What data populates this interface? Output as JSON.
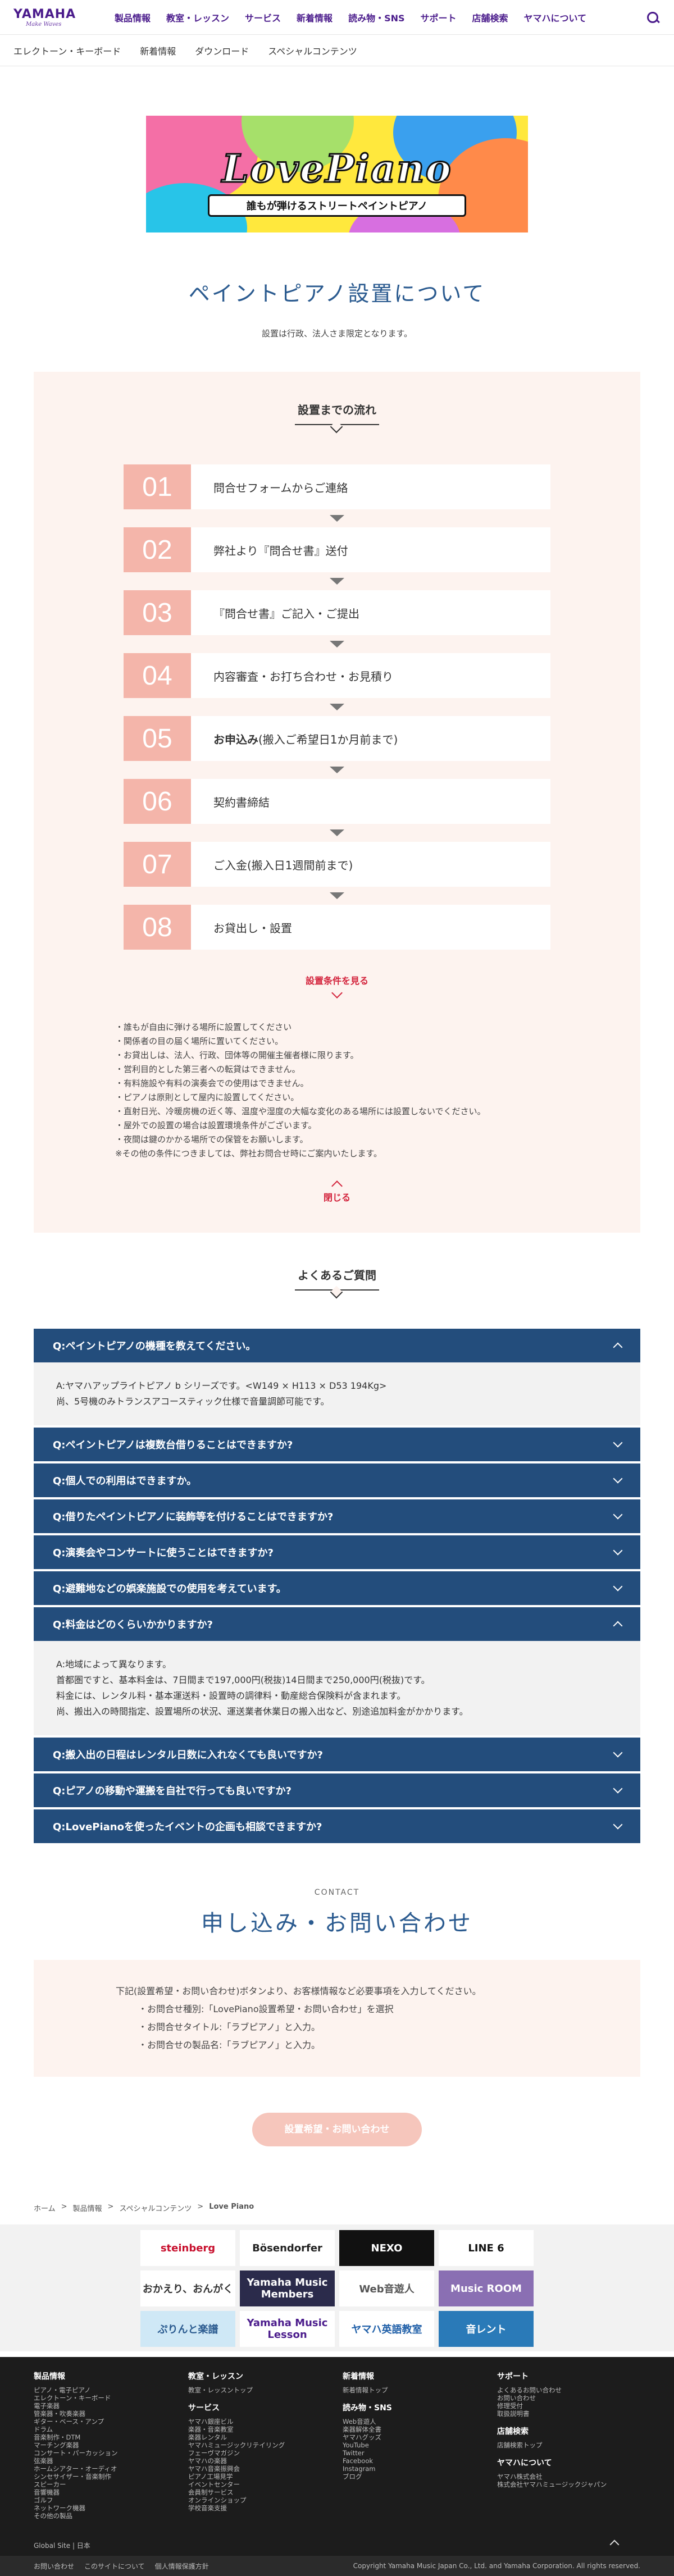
{
  "header": {
    "brand": "YAMAHA",
    "brand_sub": "Make Waves",
    "nav": [
      "製品情報",
      "教室・レッスン",
      "サービス",
      "新着情報",
      "読み物・SNS",
      "サポート",
      "店舗検索",
      "ヤマハについて"
    ]
  },
  "subnav": [
    "エレクトーン・キーボード",
    "新着情報",
    "ダウンロード",
    "スペシャルコンテンツ"
  ],
  "banner": {
    "logo_text": "LovePiano",
    "tagline": "誰もが弾けるストリートペイントピアノ"
  },
  "page": {
    "title": "ペイントピアノ設置について",
    "note": "設置は行政、法人さま限定となります。"
  },
  "flow": {
    "heading": "設置までの流れ",
    "steps": [
      {
        "num": "01",
        "label": "問合せフォームからご連絡"
      },
      {
        "num": "02",
        "label": "弊社より『問合せ書』送付"
      },
      {
        "num": "03",
        "label": "『問合せ書』ご記入・ご提出"
      },
      {
        "num": "04",
        "label": "内容審査・お打ち合わせ・お見積り"
      },
      {
        "num": "05",
        "label_strong": "お申込み",
        "label": "(搬入ご希望日1か月前まで)"
      },
      {
        "num": "06",
        "label": "契約書締結"
      },
      {
        "num": "07",
        "label": "ご入金(搬入日1週間前まで)"
      },
      {
        "num": "08",
        "label": "お貸出し・設置"
      }
    ],
    "conditions_toggle": "設置条件を見る",
    "conditions": [
      "・誰もが自由に弾ける場所に設置してください",
      "・関係者の目の届く場所に置いてください。",
      "・お貸出しは、法人、行政、団体等の開催主催者様に限ります。",
      "・営利目的とした第三者への転貸はできません。",
      "・有料施設や有料の演奏会での使用はできません。",
      "・ピアノは原則として屋内に設置してください。",
      "・直射日光、冷暖房機の近く等、温度や湿度の大幅な変化のある場所には設置しないでください。",
      "・屋外での設置の場合は設置環境条件がございます。",
      "・夜間は鍵のかかる場所での保管をお願いします。",
      "※その他の条件につきましては、弊社お問合せ時にご案内いたします。"
    ],
    "close_toggle": "閉じる"
  },
  "faq": {
    "heading": "よくあるご質問",
    "items": [
      {
        "q": "Q:ペイントピアノの機種を教えてください。",
        "open": true,
        "a": [
          "A:ヤマハアップライトピアノ b シリーズです。<W149 × H113 × D53 194Kg>",
          "尚、5号機のみトランスアコースティック仕様で音量調節可能です。"
        ]
      },
      {
        "q": "Q:ペイントピアノは複数台借りることはできますか?",
        "open": false
      },
      {
        "q": "Q:個人での利用はできますか。",
        "open": false
      },
      {
        "q": "Q:借りたペイントピアノに装飾等を付けることはできますか?",
        "open": false
      },
      {
        "q": "Q:演奏会やコンサートに使うことはできますか?",
        "open": false
      },
      {
        "q": "Q:避難地などの娯楽施設での使用を考えています。",
        "open": false
      },
      {
        "q": "Q:料金はどのくらいかかりますか?",
        "open": true,
        "a": [
          "A:地域によって異なります。",
          "首都圏ですと、基本料金は、7日間まで197,000円(税抜)14日間まで250,000円(税抜)です。",
          "料金には、レンタル料・基本運送料・設置時の調律料・動産総合保険料が含まれます。",
          "尚、搬出入の時間指定、設置場所の状況、運送業者休業日の搬入出など、別途追加料金がかかります。"
        ]
      },
      {
        "q": "Q:搬入出の日程はレンタル日数に入れなくても良いですか?",
        "open": false
      },
      {
        "q": "Q:ピアノの移動や運搬を自社で行っても良いですか?",
        "open": false
      },
      {
        "q": "Q:LovePianoを使ったイベントの企画も相談できますか?",
        "open": false
      }
    ]
  },
  "contact": {
    "eyebrow": "CONTACT",
    "title": "申し込み・お問い合わせ",
    "intro": "下記(設置希望・お問い合わせ)ボタンより、お客様情報など必要事項を入力してください。",
    "lines": [
      "・お問合せ種別:「LovePiano設置希望・お問い合わせ」を選択",
      "・お問合せタイトル:「ラブピアノ」と入力。",
      "・お問合せの製品名:「ラブピアノ」と入力。"
    ],
    "cta": "設置希望・お問い合わせ"
  },
  "breadcrumb": [
    "ホーム",
    "製品情報",
    "スペシャルコンテンツ",
    "Love Piano"
  ],
  "brands": [
    {
      "name": "steinberg",
      "bg": "#ffffff",
      "fg": "#c8102e"
    },
    {
      "name": "Bösendorfer",
      "bg": "#ffffff",
      "fg": "#222222"
    },
    {
      "name": "NEXO",
      "bg": "#111111",
      "fg": "#ffffff"
    },
    {
      "name": "LINE 6",
      "bg": "#ffffff",
      "fg": "#111111"
    },
    {
      "name": "おかえり、おんがく",
      "bg": "#ffffff",
      "fg": "#333333"
    },
    {
      "name": "Yamaha Music Members",
      "bg": "#2b2b4b",
      "fg": "#ffffff"
    },
    {
      "name": "Web音遊人",
      "bg": "#ffffff",
      "fg": "#555555"
    },
    {
      "name": "Music ROOM",
      "bg": "#8a6fb3",
      "fg": "#ffffff"
    },
    {
      "name": "ぷりんと楽譜",
      "bg": "#cfe8f6",
      "fg": "#2a5a8f"
    },
    {
      "name": "Yamaha Music Lesson",
      "bg": "#ffffff",
      "fg": "#4b1c8c"
    },
    {
      "name": "ヤマハ英語教室",
      "bg": "#ffffff",
      "fg": "#1f5fa8"
    },
    {
      "name": "音レント",
      "bg": "#2a7ab8",
      "fg": "#ffffff"
    }
  ],
  "footer": {
    "columns": [
      {
        "groups": [
          {
            "title": "製品情報",
            "links": [
              "ピアノ・電子ピアノ",
              "エレクトーン・キーボード",
              "電子楽器",
              "管楽器・吹奏楽器",
              "ギター・ベース・アンプ",
              "ドラム",
              "音楽制作・DTM",
              "マーチング楽器",
              "コンサート・パーカッション",
              "弦楽器",
              "ホームシアター・オーディオ",
              "シンセサイザー・音楽制作",
              "スピーカー",
              "音響機器",
              "ゴルフ",
              "ネットワーク機器",
              "その他の製品"
            ]
          }
        ]
      },
      {
        "groups": [
          {
            "title": "教室・レッスン",
            "links": [
              "教室・レッスントップ"
            ]
          },
          {
            "title": "サービス",
            "links": [
              "ヤマハ銀座ビル",
              "楽器・音楽教室",
              "楽器レンタル",
              "ヤマハミュージックリテイリング",
              "フェーヴマガジン",
              "ヤマハの楽器",
              "ヤマハ音楽振興会",
              "ピアノ工場見学",
              "イベントセンター",
              "会員制サービス",
              "オンラインショップ",
              "学校音楽支援"
            ]
          }
        ]
      },
      {
        "groups": [
          {
            "title": "新着情報",
            "links": [
              "新着情報トップ"
            ]
          },
          {
            "title": "読み物・SNS",
            "links": [
              "Web音遊人",
              "楽器解体全書",
              "ヤマハグッズ",
              "YouTube",
              "Twitter",
              "Facebook",
              "Instagram",
              "ブログ"
            ]
          }
        ]
      },
      {
        "groups": [
          {
            "title": "サポート",
            "links": [
              "よくあるお問い合わせ",
              "お問い合わせ",
              "修理受付",
              "取扱説明書"
            ]
          },
          {
            "title": "店舗検索",
            "links": [
              "店舗検索トップ"
            ]
          },
          {
            "title": "ヤマハについて",
            "links": [
              "ヤマハ株式会社",
              "株式会社ヤマハミュージックジャパン"
            ]
          }
        ]
      }
    ],
    "global": "Global Site  |  日本",
    "bottom_links": [
      "お問い合わせ",
      "このサイトについて",
      "個人情報保護方針"
    ],
    "copyright": "Copyright Yamaha Music Japan Co., Ltd. and Yamaha Corporation. All rights reserved."
  }
}
